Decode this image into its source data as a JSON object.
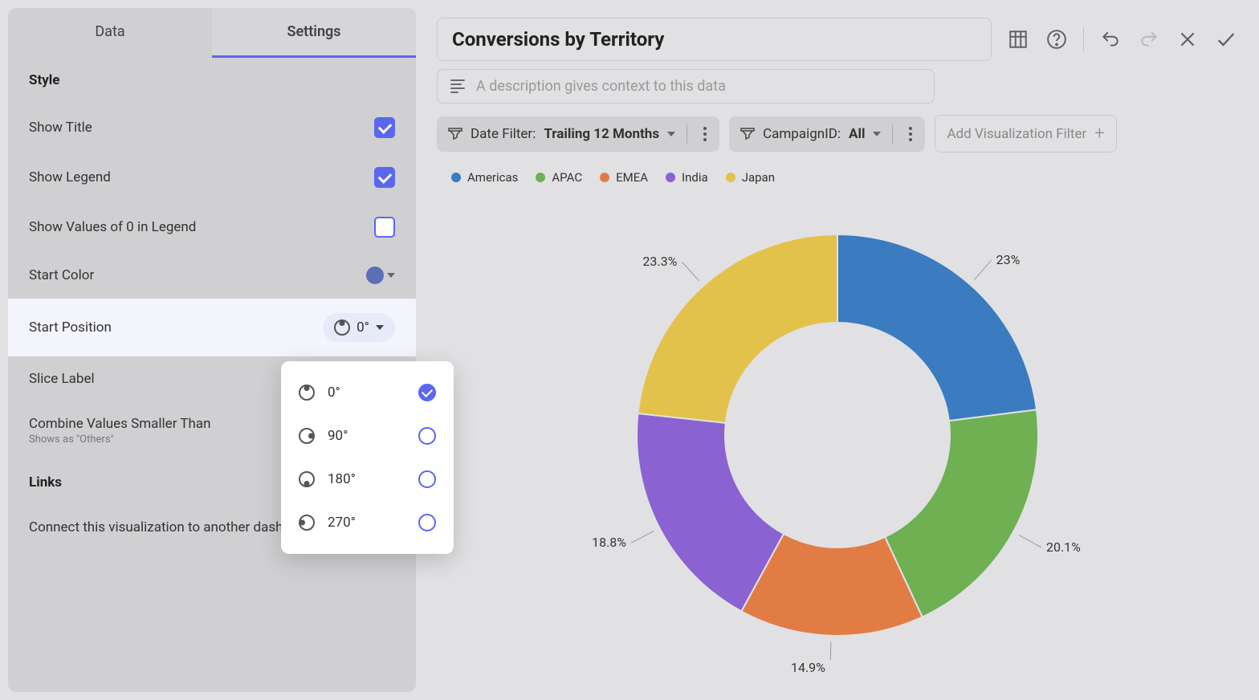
{
  "tabs": {
    "data": "Data",
    "settings": "Settings"
  },
  "sections": {
    "style": "Style",
    "links": "Links"
  },
  "settings": {
    "show_title": "Show Title",
    "show_legend": "Show Legend",
    "show_zero": "Show Values of 0 in Legend",
    "start_color": "Start Color",
    "start_position": "Start Position",
    "start_position_value": "0°",
    "slice_label": "Slice Label",
    "combine": "Combine Values Smaller Than",
    "combine_sub": "Shows as \"Others\"",
    "connect": "Connect this visualization to another dashboard or URL"
  },
  "dropdown_options": [
    "0°",
    "90°",
    "180°",
    "270°"
  ],
  "header": {
    "title": "Conversions by Territory",
    "desc_placeholder": "A description gives context to this data"
  },
  "filters": {
    "date_label": "Date Filter:",
    "date_value": "Trailing 12 Months",
    "campaign_label": "CampaignID:",
    "campaign_value": "All",
    "add": "Add Visualization Filter"
  },
  "chart_data": {
    "type": "pie",
    "title": "Conversions by Territory",
    "series": [
      {
        "name": "Americas",
        "value": 23.0,
        "color": "#3b7bbf"
      },
      {
        "name": "APAC",
        "value": 20.1,
        "color": "#6fb053"
      },
      {
        "name": "EMEA",
        "value": 14.9,
        "color": "#e27c45"
      },
      {
        "name": "India",
        "value": 18.8,
        "color": "#8a62d1"
      },
      {
        "name": "Japan",
        "value": 23.3,
        "color": "#e2c24a"
      }
    ],
    "labels": [
      "23%",
      "20.1%",
      "14.9%",
      "18.8%",
      "23.3%"
    ],
    "donut": true,
    "legend_position": "top"
  }
}
